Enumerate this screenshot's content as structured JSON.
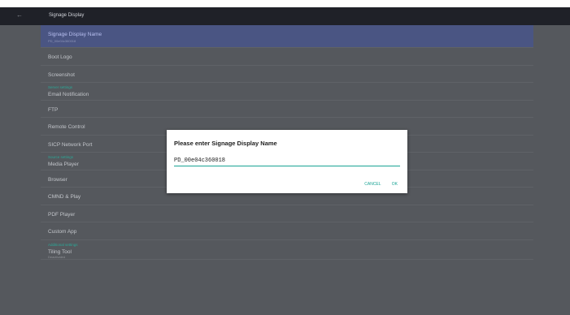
{
  "appbar": {
    "back_icon": "arrow-left-icon",
    "back_glyph": "←",
    "title": "Signage Display"
  },
  "list": {
    "items": [
      {
        "label": "Signage Display Name",
        "sub": "PD_00e04c360018",
        "selected": true
      },
      {
        "label": "Boot Logo"
      },
      {
        "label": "Screenshot"
      },
      {
        "header": "Server settings",
        "label": "Email Notification"
      },
      {
        "label": "FTP"
      },
      {
        "label": "Remote Control"
      },
      {
        "label": "SICP Network Port"
      },
      {
        "header": "Source settings",
        "label": "Media Player"
      },
      {
        "label": "Browser"
      },
      {
        "label": "CMND & Play"
      },
      {
        "label": "PDF Player"
      },
      {
        "label": "Custom App"
      },
      {
        "header": "Additional settings",
        "label": "Tiling Tool",
        "sub": "Deactivated"
      }
    ]
  },
  "dialog": {
    "title": "Please enter Signage Display Name",
    "input_value": "PD_00e04c360018",
    "cancel_label": "CANCEL",
    "ok_label": "OK"
  },
  "colors": {
    "accent": "#1aa394",
    "selected_row": "#4a5583",
    "dim_background": "#55585d",
    "appbar": "#1f2128"
  }
}
